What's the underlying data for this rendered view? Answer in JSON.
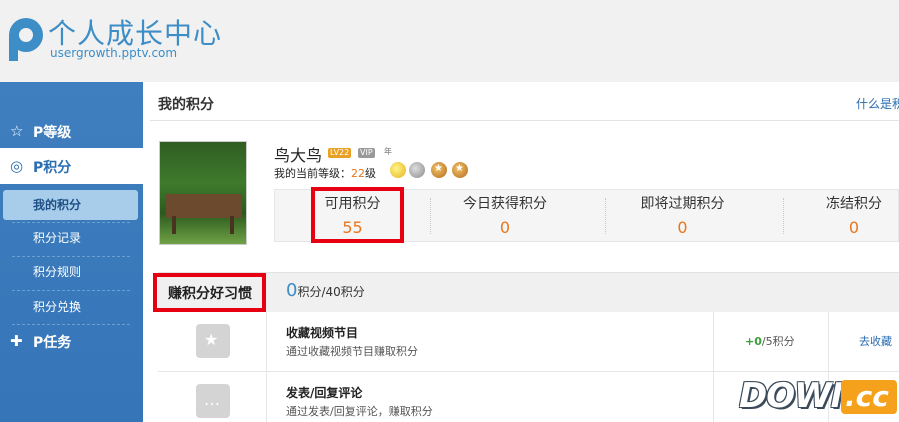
{
  "header": {
    "title": "个人成长中心",
    "url": "usergrowth.pptv.com"
  },
  "sidebar": {
    "level": "P等级",
    "points": "P积分",
    "sub": [
      "我的积分",
      "积分记录",
      "积分规则",
      "积分兑换"
    ],
    "task": "P任务"
  },
  "main": {
    "title": "我的积分",
    "help_link": "什么是积",
    "user": {
      "name": "鸟大鸟",
      "badge_lv": "LV22",
      "badge_vip": "VIP",
      "badge_year": "年",
      "level_prefix": "我的当前等级：",
      "level": "22",
      "level_suffix": "级"
    },
    "stats": [
      {
        "label": "可用积分",
        "value": "55"
      },
      {
        "label": "今日获得积分",
        "value": "0"
      },
      {
        "label": "即将过期积分",
        "value": "0"
      },
      {
        "label": "冻结积分",
        "value": "0"
      }
    ],
    "habits": {
      "title": "赚积分好习惯",
      "earned": "0",
      "total_text": "积分/40积分",
      "rows": [
        {
          "title": "收藏视频节目",
          "desc": "通过收藏视频节目赚取积分",
          "earned": "+0",
          "limit": "/5积分",
          "action": "去收藏"
        },
        {
          "title": "发表/回复评论",
          "desc": "通过发表/回复评论，赚取积分",
          "earned": "",
          "limit": "",
          "action": ""
        }
      ]
    }
  },
  "watermark": {
    "text": "DOWN",
    "suffix": ".cc"
  },
  "colors": {
    "accent": "#3d8dc6",
    "sidebar": "#3a7abc",
    "highlight": "#e8761e",
    "annotation": "#e60012"
  }
}
